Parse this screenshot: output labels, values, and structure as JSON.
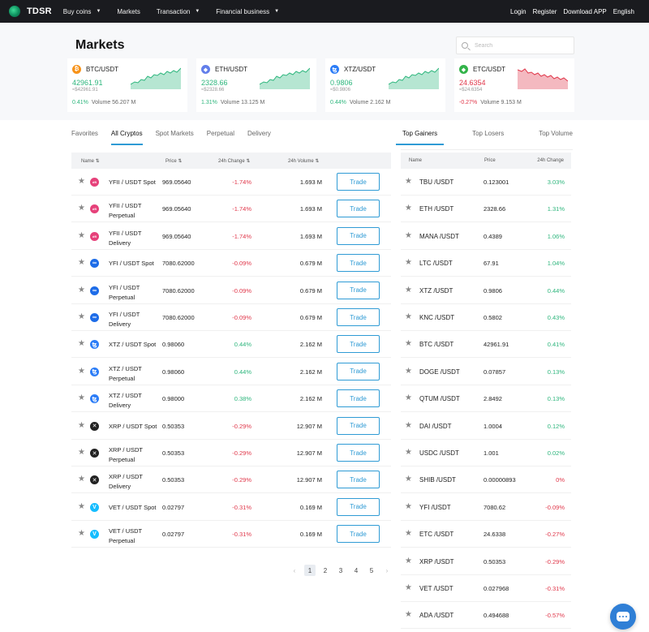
{
  "nav": {
    "brand": "TDSR",
    "links": [
      {
        "label": "Buy coins",
        "dropdown": true
      },
      {
        "label": "Markets",
        "dropdown": false
      },
      {
        "label": "Transaction",
        "dropdown": true
      },
      {
        "label": "Financial business",
        "dropdown": true
      }
    ],
    "right": [
      "Login",
      "Register",
      "Download APP",
      "English"
    ]
  },
  "header": {
    "title": "Markets",
    "search_placeholder": "Search"
  },
  "tickers": [
    {
      "pair": "BTC/USDT",
      "icon": "bitcoin-icon",
      "icon_glyph": "₿",
      "icon_color": "#f7931a",
      "price": "42961.91",
      "fiat": "≈$42961.91",
      "change": "0.41%",
      "volume": "Volume 56.207 M",
      "trend": "up"
    },
    {
      "pair": "ETH/USDT",
      "icon": "ethereum-icon",
      "icon_glyph": "◆",
      "icon_color": "#627eea",
      "price": "2328.66",
      "fiat": "≈$2328.66",
      "change": "1.31%",
      "volume": "Volume 13.125 M",
      "trend": "up"
    },
    {
      "pair": "XTZ/USDT",
      "icon": "tezos-icon",
      "icon_glyph": "ꜩ",
      "icon_color": "#2c7df7",
      "price": "0.9806",
      "fiat": "≈$0.9806",
      "change": "0.44%",
      "volume": "Volume 2.162 M",
      "trend": "up"
    },
    {
      "pair": "ETC/USDT",
      "icon": "ethereum-classic-icon",
      "icon_glyph": "◆",
      "icon_color": "#33b34a",
      "price": "24.6354",
      "fiat": "≈$24.6354",
      "change": "-0.27%",
      "volume": "Volume 9.153 M",
      "trend": "down"
    }
  ],
  "left_tabs": [
    "Favorites",
    "All Cryptos",
    "Spot Markets",
    "Perpetual",
    "Delivery"
  ],
  "left_active_tab": 1,
  "left_headers": {
    "name": "Name",
    "price": "Price",
    "change": "24h Change",
    "volume": "24h Volume"
  },
  "trade_label": "Trade",
  "markets": [
    {
      "name": [
        "YFII / USDT Spot"
      ],
      "icon": "dfi-icon",
      "glyph": "dfi",
      "color": "#e6417a",
      "price": "969.05640",
      "change": "-1.74%",
      "dir": "down",
      "volume": "1.693 M"
    },
    {
      "name": [
        "YFII / USDT",
        "Perpetual"
      ],
      "icon": "dfi-icon",
      "glyph": "dfi",
      "color": "#e6417a",
      "price": "969.05640",
      "change": "-1.74%",
      "dir": "down",
      "volume": "1.693 M"
    },
    {
      "name": [
        "YFII / USDT",
        "Delivery"
      ],
      "icon": "dfi-icon",
      "glyph": "dfi",
      "color": "#e6417a",
      "price": "969.05640",
      "change": "-1.74%",
      "dir": "down",
      "volume": "1.693 M"
    },
    {
      "name": [
        "YFI / USDT Spot"
      ],
      "icon": "yearn-icon",
      "glyph": "∞",
      "color": "#1d6ce8",
      "price": "7080.62000",
      "change": "-0.09%",
      "dir": "down",
      "volume": "0.679 M"
    },
    {
      "name": [
        "YFI / USDT",
        "Perpetual"
      ],
      "icon": "yearn-icon",
      "glyph": "∞",
      "color": "#1d6ce8",
      "price": "7080.62000",
      "change": "-0.09%",
      "dir": "down",
      "volume": "0.679 M"
    },
    {
      "name": [
        "YFI / USDT",
        "Delivery"
      ],
      "icon": "yearn-icon",
      "glyph": "∞",
      "color": "#1d6ce8",
      "price": "7080.62000",
      "change": "-0.09%",
      "dir": "down",
      "volume": "0.679 M"
    },
    {
      "name": [
        "XTZ / USDT Spot"
      ],
      "icon": "tezos-icon",
      "glyph": "ꜩ",
      "color": "#2c7df7",
      "price": "0.98060",
      "change": "0.44%",
      "dir": "up",
      "volume": "2.162 M"
    },
    {
      "name": [
        "XTZ / USDT",
        "Perpetual"
      ],
      "icon": "tezos-icon",
      "glyph": "ꜩ",
      "color": "#2c7df7",
      "price": "0.98060",
      "change": "0.44%",
      "dir": "up",
      "volume": "2.162 M"
    },
    {
      "name": [
        "XTZ / USDT",
        "Delivery"
      ],
      "icon": "tezos-icon",
      "glyph": "ꜩ",
      "color": "#2c7df7",
      "price": "0.98000",
      "change": "0.38%",
      "dir": "up",
      "volume": "2.162 M"
    },
    {
      "name": [
        "XRP / USDT Spot"
      ],
      "icon": "xrp-icon",
      "glyph": "✕",
      "color": "#222222",
      "price": "0.50353",
      "change": "-0.29%",
      "dir": "down",
      "volume": "12.907 M"
    },
    {
      "name": [
        "XRP / USDT",
        "Perpetual"
      ],
      "icon": "xrp-icon",
      "glyph": "✕",
      "color": "#222222",
      "price": "0.50353",
      "change": "-0.29%",
      "dir": "down",
      "volume": "12.907 M"
    },
    {
      "name": [
        "XRP / USDT",
        "Delivery"
      ],
      "icon": "xrp-icon",
      "glyph": "✕",
      "color": "#222222",
      "price": "0.50353",
      "change": "-0.29%",
      "dir": "down",
      "volume": "12.907 M"
    },
    {
      "name": [
        "VET / USDT Spot"
      ],
      "icon": "vechain-icon",
      "glyph": "V",
      "color": "#15bdff",
      "price": "0.02797",
      "change": "-0.31%",
      "dir": "down",
      "volume": "0.169 M"
    },
    {
      "name": [
        "VET / USDT",
        "Perpetual"
      ],
      "icon": "vechain-icon",
      "glyph": "V",
      "color": "#15bdff",
      "price": "0.02797",
      "change": "-0.31%",
      "dir": "down",
      "volume": "0.169 M"
    }
  ],
  "pagination": {
    "pages": [
      "1",
      "2",
      "3",
      "4",
      "5"
    ],
    "current": "1",
    "prev": "‹",
    "next": "›"
  },
  "right_tabs": [
    "Top Gainers",
    "Top Losers",
    "Top Volume"
  ],
  "right_active_tab": 0,
  "right_headers": {
    "name": "Name",
    "price": "Price",
    "change": "24h Change"
  },
  "gainers": [
    {
      "pair": "TBU /USDT",
      "price": "0.123001",
      "change": "3.03%",
      "dir": "up"
    },
    {
      "pair": "ETH /USDT",
      "price": "2328.66",
      "change": "1.31%",
      "dir": "up"
    },
    {
      "pair": "MANA /USDT",
      "price": "0.4389",
      "change": "1.06%",
      "dir": "up"
    },
    {
      "pair": "LTC /USDT",
      "price": "67.91",
      "change": "1.04%",
      "dir": "up"
    },
    {
      "pair": "XTZ /USDT",
      "price": "0.9806",
      "change": "0.44%",
      "dir": "up"
    },
    {
      "pair": "KNC /USDT",
      "price": "0.5802",
      "change": "0.43%",
      "dir": "up"
    },
    {
      "pair": "BTC /USDT",
      "price": "42961.91",
      "change": "0.41%",
      "dir": "up"
    },
    {
      "pair": "DOGE /USDT",
      "price": "0.07857",
      "change": "0.13%",
      "dir": "up"
    },
    {
      "pair": "QTUM /USDT",
      "price": "2.8492",
      "change": "0.13%",
      "dir": "up"
    },
    {
      "pair": "DAI /USDT",
      "price": "1.0004",
      "change": "0.12%",
      "dir": "up"
    },
    {
      "pair": "USDC /USDT",
      "price": "1.001",
      "change": "0.02%",
      "dir": "up"
    },
    {
      "pair": "SHIB /USDT",
      "price": "0.00000893",
      "change": "0%",
      "dir": "down"
    },
    {
      "pair": "YFI /USDT",
      "price": "7080.62",
      "change": "-0.09%",
      "dir": "down"
    },
    {
      "pair": "ETC /USDT",
      "price": "24.6338",
      "change": "-0.27%",
      "dir": "down"
    },
    {
      "pair": "XRP /USDT",
      "price": "0.50353",
      "change": "-0.29%",
      "dir": "down"
    },
    {
      "pair": "VET /USDT",
      "price": "0.027968",
      "change": "-0.31%",
      "dir": "down"
    },
    {
      "pair": "ADA /USDT",
      "price": "0.494688",
      "change": "-0.57%",
      "dir": "down"
    }
  ],
  "colors": {
    "up": "#2eb67d",
    "down": "#e0374a",
    "accent": "#2f9bd5"
  }
}
